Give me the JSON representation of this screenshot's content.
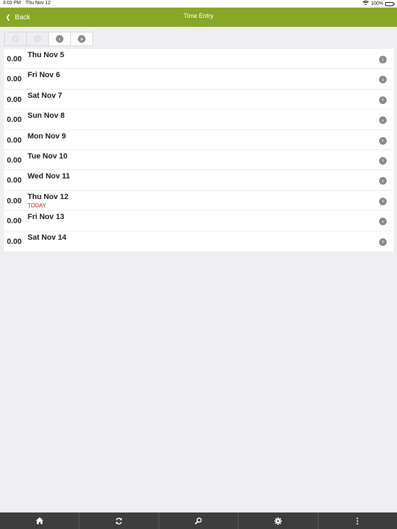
{
  "status_bar": {
    "time": "3:03 PM",
    "date": "Thu Nov 12",
    "battery": "100%"
  },
  "nav": {
    "back_label": "Back",
    "title": "Time Entry"
  },
  "pager": {
    "buttons": [
      {
        "icon": "first-page-icon",
        "enabled": false
      },
      {
        "icon": "previous-page-icon",
        "enabled": false
      },
      {
        "icon": "next-page-icon",
        "enabled": true
      },
      {
        "icon": "last-page-icon",
        "enabled": true
      }
    ]
  },
  "days": [
    {
      "hours": "0.00",
      "label": "Thu Nov 5",
      "badge": ""
    },
    {
      "hours": "0.00",
      "label": "Fri Nov 6",
      "badge": ""
    },
    {
      "hours": "0.00",
      "label": "Sat Nov 7",
      "badge": ""
    },
    {
      "hours": "0.00",
      "label": "Sun Nov 8",
      "badge": ""
    },
    {
      "hours": "0.00",
      "label": "Mon Nov 9",
      "badge": ""
    },
    {
      "hours": "0.00",
      "label": "Tue Nov 10",
      "badge": ""
    },
    {
      "hours": "0.00",
      "label": "Wed Nov 11",
      "badge": ""
    },
    {
      "hours": "0.00",
      "label": "Thu Nov 12",
      "badge": "TODAY"
    },
    {
      "hours": "0.00",
      "label": "Fri Nov 13",
      "badge": ""
    },
    {
      "hours": "0.00",
      "label": "Sat Nov 14",
      "badge": ""
    }
  ],
  "tab_bar": {
    "tabs": [
      {
        "icon": "home-icon"
      },
      {
        "icon": "refresh-icon"
      },
      {
        "icon": "search-icon"
      },
      {
        "icon": "gear-icon"
      },
      {
        "icon": "more-icon"
      }
    ]
  },
  "colors": {
    "nav_green": "#88a725",
    "today_red": "#d0121b",
    "tab_bar_bg": "#3e3e3e"
  }
}
